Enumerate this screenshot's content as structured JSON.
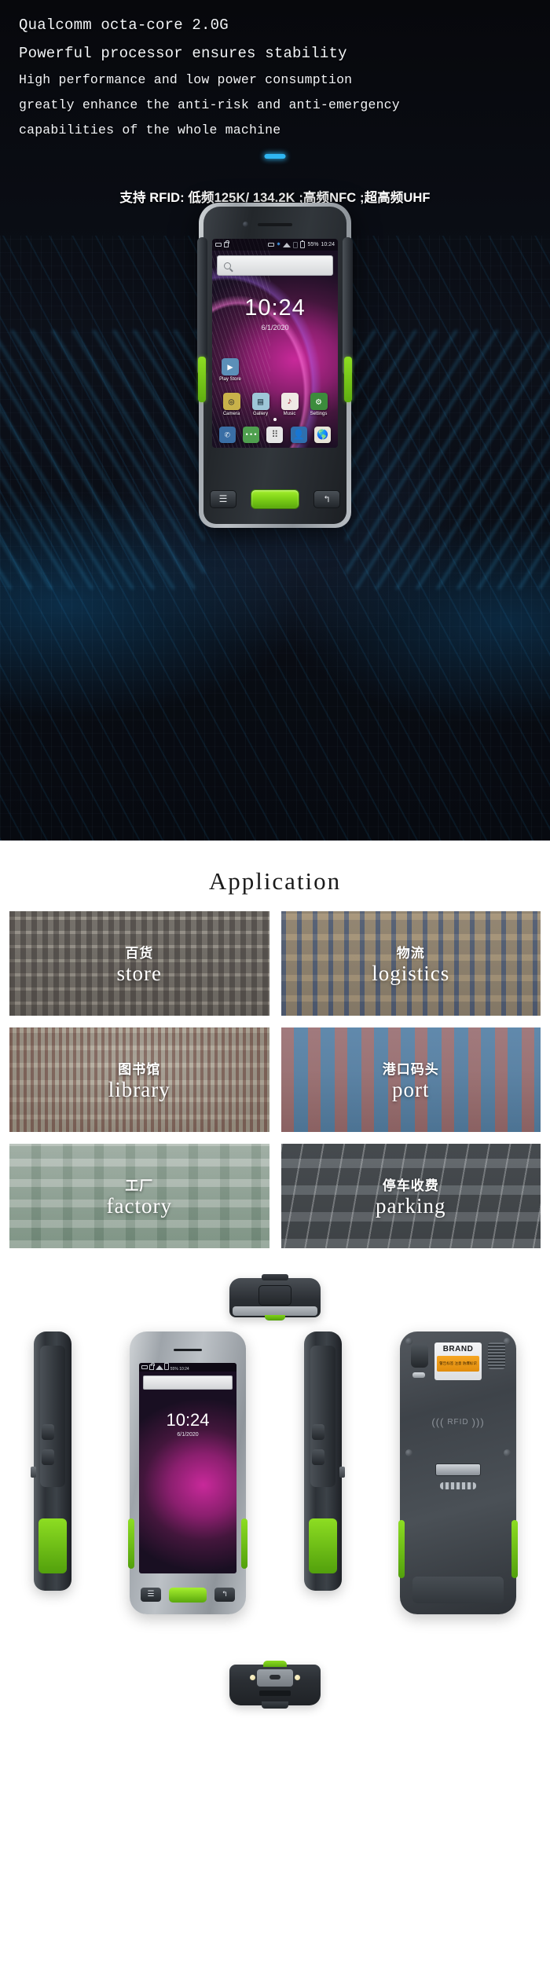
{
  "hero": {
    "spec_lines": [
      "Qualcomm octa-core 2.0G",
      "Powerful processor ensures stability",
      "High performance and low power consumption",
      "greatly enhance the anti-risk and anti-emergency",
      "capabilities of the whole machine"
    ],
    "rfid_support": "支持 RFID: 低频125K/ 134.2K ;高频NFC ;超高频UHF",
    "accent_color": "#2fb6f2"
  },
  "phone": {
    "status_bar": {
      "sms_icon": "sms-icon",
      "lock_icon": "lock-icon",
      "usb_icon": "usb-icon",
      "bluetooth_glyph": "✷",
      "wifi_icon": "wifi-icon",
      "sim_icon": "sim-icon",
      "battery_icon": "battery-icon",
      "battery_percent": "55%",
      "time": "10:24"
    },
    "search_placeholder": "",
    "lock_clock": "10:24",
    "lock_date": "6/1/2020",
    "apps_top": [
      {
        "label": "Play Store",
        "glyph": "▶",
        "bg": "#5c8fb8"
      }
    ],
    "apps_mid": [
      {
        "label": "Camera",
        "glyph": "◎",
        "bg": "#c9b24a"
      },
      {
        "label": "Gallery",
        "glyph": "▤",
        "bg": "#9ec6d8"
      },
      {
        "label": "Music",
        "glyph": "♪",
        "bg": "#efe9e4"
      },
      {
        "label": "Settings",
        "glyph": "⚙",
        "bg": "#3c8c3c"
      }
    ],
    "dock": [
      {
        "name": "phone-app",
        "glyph": "✆",
        "bg": "#3a6ea5"
      },
      {
        "name": "messages-app",
        "glyph": "•••",
        "bg": "#4f9f4f"
      },
      {
        "name": "app-drawer",
        "glyph": "⠿",
        "bg": "#e6e6e6"
      },
      {
        "name": "contacts-app",
        "glyph": "👤",
        "bg": "#2f6fae"
      },
      {
        "name": "browser-app",
        "glyph": "🌐",
        "bg": "#e8e4d8"
      }
    ],
    "hardware_keys": {
      "menu_glyph": "☰",
      "scan_label": "",
      "back_glyph": "↰"
    }
  },
  "application": {
    "title": "Application",
    "cards": [
      {
        "cn": "百货",
        "en": "store",
        "photo": "ph-store"
      },
      {
        "cn": "物流",
        "en": "logistics",
        "photo": "ph-logistics"
      },
      {
        "cn": "图书馆",
        "en": "library",
        "photo": "ph-library"
      },
      {
        "cn": "港口码头",
        "en": "port",
        "photo": "ph-port"
      },
      {
        "cn": "工厂",
        "en": "factory",
        "photo": "ph-factory"
      },
      {
        "cn": "停车收费",
        "en": "parking",
        "photo": "ph-parking"
      }
    ]
  },
  "views": {
    "back": {
      "brand_label": "BRAND",
      "sticker_text": "警告标签 注意 防爆标识",
      "rfid_label": "RFID",
      "rfid_arc_left": "((( ",
      "rfid_arc_right": " )))"
    }
  }
}
